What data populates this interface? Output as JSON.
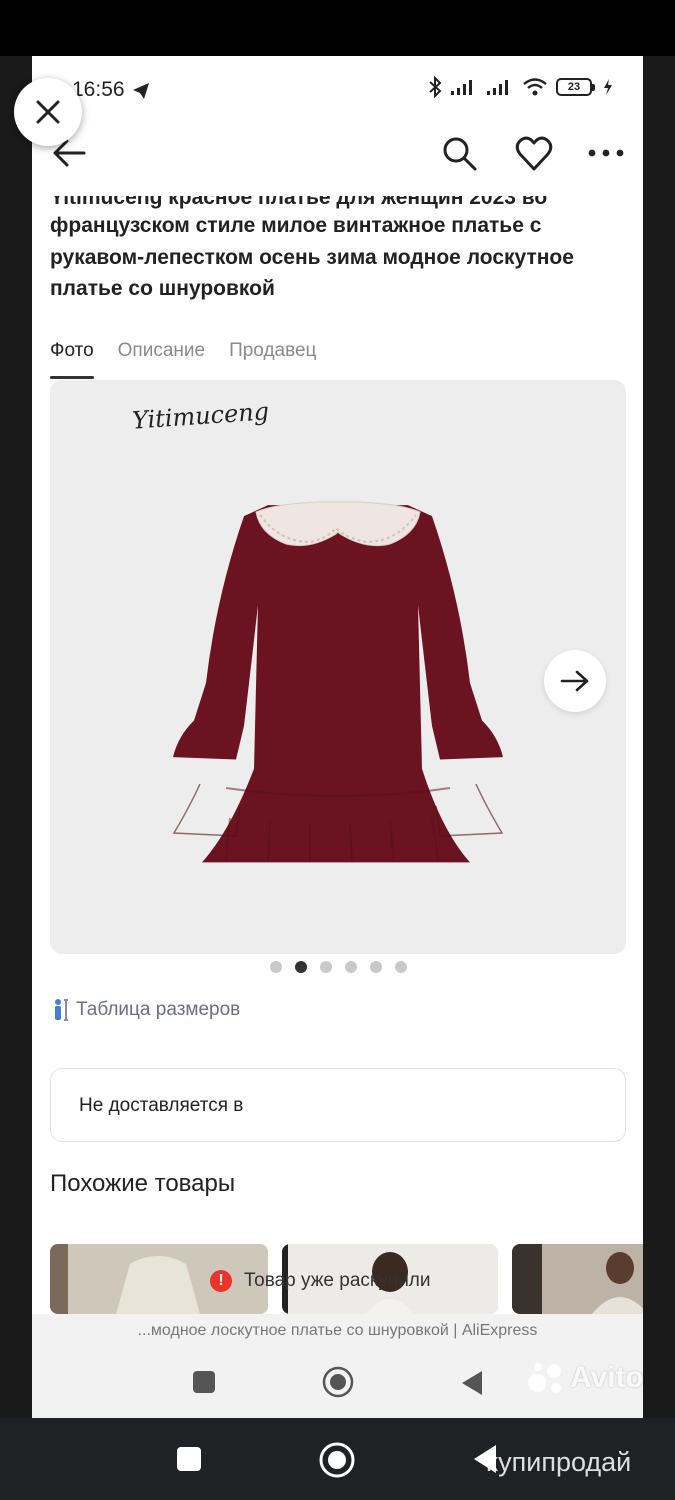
{
  "status_bar": {
    "time": "16:56",
    "battery": "23"
  },
  "product": {
    "title_top_clipped": "Yitimuceng красное платье для женщин 2023 во",
    "title": "французском стиле милое винтажное платье с рукавом-лепестком осень зима модное лоскутное платье со шнуровкой"
  },
  "tabs": [
    {
      "label": "Фото"
    },
    {
      "label": "Описание"
    },
    {
      "label": "Продавец"
    }
  ],
  "gallery": {
    "brand_mark": "Yitimuceng",
    "page_count": 6,
    "active_index": 1
  },
  "size_table_link": "Таблица размеров",
  "delivery": {
    "text": "Не доставляется в"
  },
  "similar": {
    "heading": "Похожие товары"
  },
  "toast": {
    "text": "Товар уже раскупили",
    "icon": "!"
  },
  "page_caption": "...модное лоскутное платье со шнуровкой | AliExpress",
  "watermarks": {
    "avito": "Avito",
    "kupiprodai": "купипродай"
  },
  "colors": {
    "dress": "#6b1320",
    "collar": "#efe6e1",
    "toast_icon": "#e8342a"
  }
}
